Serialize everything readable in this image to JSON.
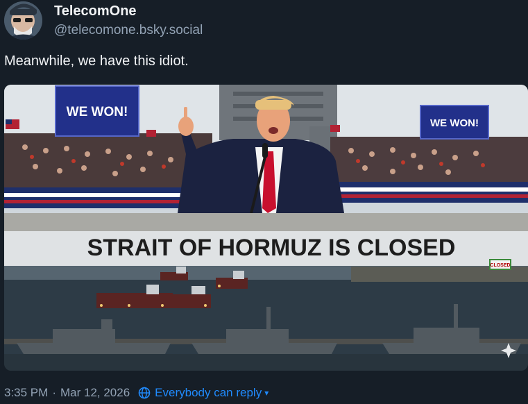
{
  "post": {
    "author": {
      "display_name": "TelecomOne",
      "handle": "@telecomone.bsky.social"
    },
    "text": "Meanwhile, we have this idiot.",
    "timestamp": "3:35 PM",
    "separator": "·",
    "date": "Mar 12, 2026",
    "reply_setting": "Everybody can reply"
  },
  "image": {
    "sign_left": "WE WON!",
    "sign_right": "WE WON!",
    "headline": "STRAIT OF HORMUZ IS CLOSED",
    "small_sign": "CLOSED"
  },
  "colors": {
    "background": "#161e27",
    "link": "#208bfe",
    "muted": "#93a3b5"
  },
  "icons": {
    "reply_setting": "globe-icon",
    "dropdown": "chevron-down-icon",
    "sparkle": "sparkle-icon"
  }
}
